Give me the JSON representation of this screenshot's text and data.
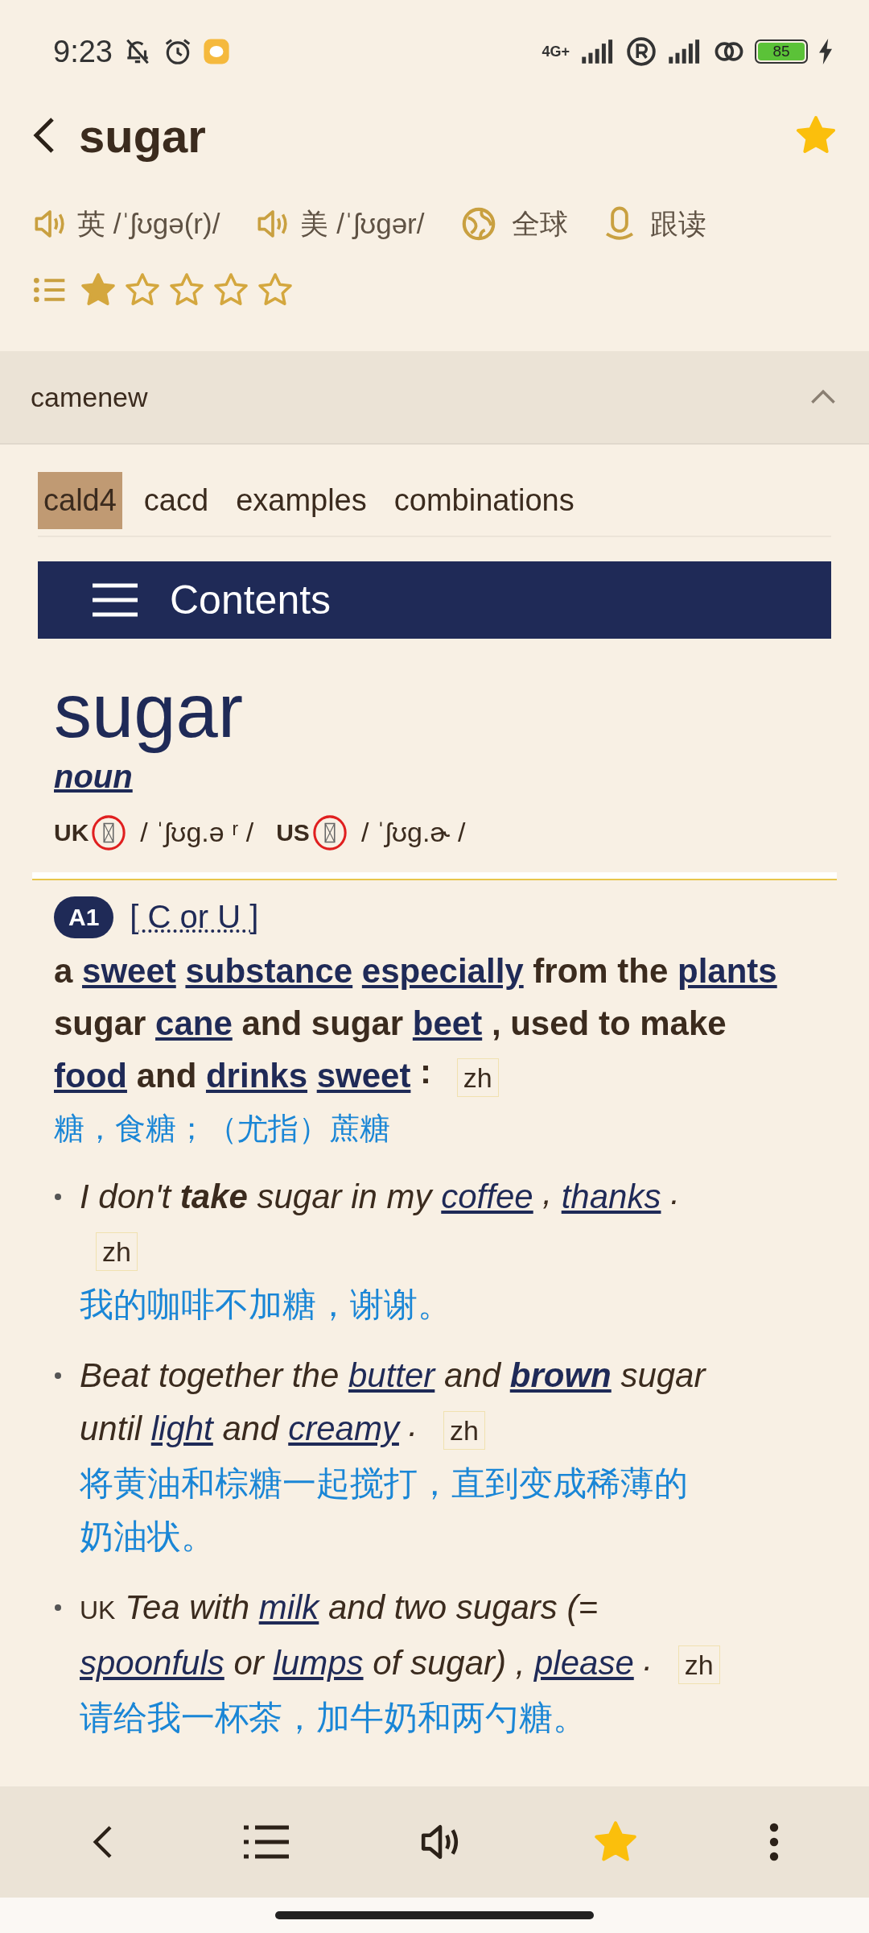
{
  "status_bar": {
    "time": "9:23",
    "network": "4G+",
    "battery": "85"
  },
  "header": {
    "title": "sugar",
    "favorite": true
  },
  "pronunciations": [
    {
      "label": "英 /ˈʃʊɡə(r)/"
    },
    {
      "label": "美 /ˈʃʊɡər/"
    }
  ],
  "actions": [
    {
      "kind": "globe",
      "label": "全球"
    },
    {
      "kind": "mic",
      "label": "跟读"
    }
  ],
  "rating": {
    "stars": 1
  },
  "section": {
    "title": "camenew",
    "expanded": true
  },
  "tabs": [
    {
      "label": "cald4",
      "selected": true
    },
    {
      "label": "cacd",
      "selected": false
    },
    {
      "label": "examples",
      "selected": false
    },
    {
      "label": "combinations",
      "selected": false
    }
  ],
  "contents_bar": {
    "label": "Contents"
  },
  "entry": {
    "headword": "sugar",
    "pos": "noun",
    "pron": [
      {
        "region": "UK",
        "ipa": "/ ˈʃʊɡ.ə ʳ /"
      },
      {
        "region": "US",
        "ipa": "/ ˈʃʊɡ.ɚ /"
      }
    ],
    "level": "A1",
    "grammar": "[ C or U ]",
    "definition": [
      {
        "t": "a",
        "kind": "text"
      },
      {
        "t": "sweet",
        "kind": "link"
      },
      {
        "t": "substance",
        "kind": "link"
      },
      {
        "t": "especially",
        "kind": "link"
      },
      {
        "t": "from the",
        "kind": "text"
      },
      {
        "t": "plants",
        "kind": "link"
      },
      {
        "t": "sugar",
        "kind": "text"
      },
      {
        "t": "cane",
        "kind": "link"
      },
      {
        "t": "and sugar",
        "kind": "text"
      },
      {
        "t": "beet",
        "kind": "link"
      },
      {
        "t": ", used to make",
        "kind": "text"
      },
      {
        "t": "food",
        "kind": "link"
      },
      {
        "t": "and",
        "kind": "text"
      },
      {
        "t": "drinks",
        "kind": "link"
      },
      {
        "t": "sweet",
        "kind": "link"
      },
      {
        "t": ":",
        "kind": "punct"
      }
    ],
    "zh_tag": "zh",
    "translation": "糖，食糖；（尤指）蔗糖",
    "examples": [
      {
        "segments": [
          {
            "t": "I don't",
            "kind": "text"
          },
          {
            "t": "take",
            "kind": "bold"
          },
          {
            "t": "sugar in my",
            "kind": "text"
          },
          {
            "t": "coffee",
            "kind": "link"
          },
          {
            "t": ",",
            "kind": "punct"
          },
          {
            "t": "thanks",
            "kind": "link"
          },
          {
            "t": ".",
            "kind": "punct"
          }
        ],
        "zh_tag": "zh",
        "translation": "我的咖啡不加糖，谢谢。"
      },
      {
        "segments": [
          {
            "t": "Beat together the",
            "kind": "text"
          },
          {
            "t": "butter",
            "kind": "link"
          },
          {
            "t": "and",
            "kind": "text"
          },
          {
            "t": "brown",
            "kind": "bold_link"
          },
          {
            "t": "sugar until",
            "kind": "text"
          },
          {
            "t": "light",
            "kind": "link"
          },
          {
            "t": "and",
            "kind": "text"
          },
          {
            "t": "creamy",
            "kind": "link"
          },
          {
            "t": ".",
            "kind": "punct"
          }
        ],
        "zh_tag": "zh",
        "translation": "将黄油和棕糖一起搅打，直到变成稀薄的奶油状。"
      },
      {
        "segments": [
          {
            "t": "UK",
            "kind": "label"
          },
          {
            "t": "Tea with",
            "kind": "text"
          },
          {
            "t": "milk",
            "kind": "link"
          },
          {
            "t": "and two sugars (=",
            "kind": "text"
          },
          {
            "t": "spoonfuls",
            "kind": "link"
          },
          {
            "t": "or",
            "kind": "text"
          },
          {
            "t": "lumps",
            "kind": "link"
          },
          {
            "t": "of sugar) ,",
            "kind": "text"
          },
          {
            "t": "please",
            "kind": "link"
          },
          {
            "t": ".",
            "kind": "punct"
          }
        ],
        "zh_tag": "zh",
        "translation": "请给我一杯茶，加牛奶和两勺糖。"
      }
    ]
  },
  "bottom_nav": {
    "favorite": true
  }
}
